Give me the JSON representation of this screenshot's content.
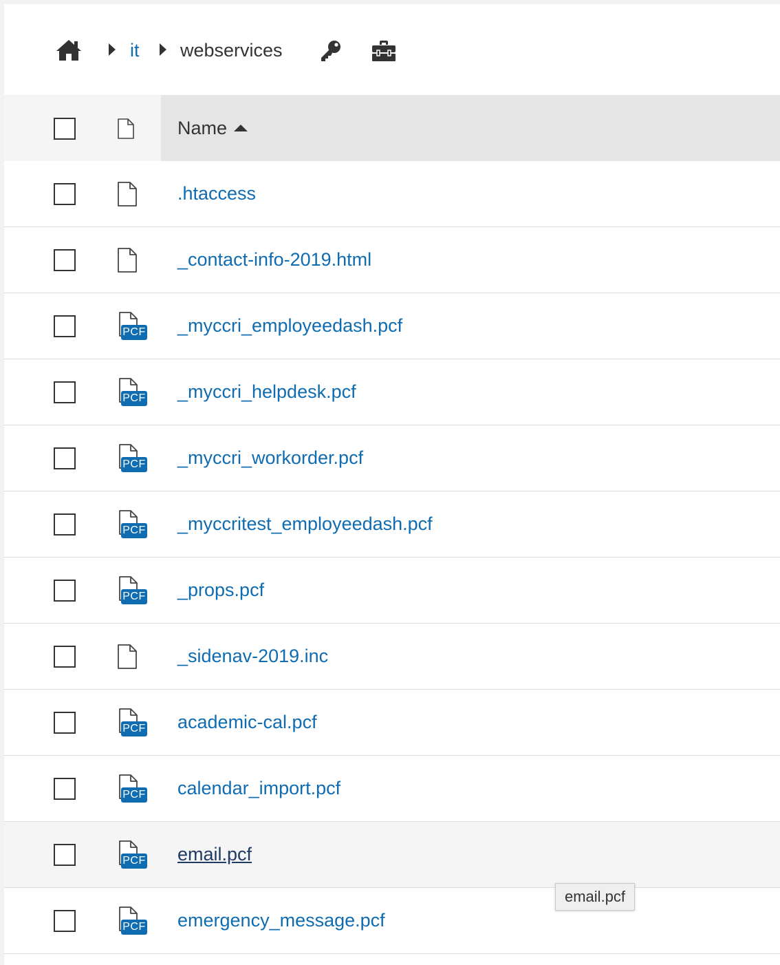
{
  "breadcrumb": {
    "home_icon": "home-icon",
    "separator_icon": "caret-right-icon",
    "items": [
      {
        "label": "it",
        "link": true
      },
      {
        "label": "webservices",
        "link": false
      }
    ],
    "actions": [
      "key-icon",
      "toolbox-icon"
    ]
  },
  "table": {
    "header": {
      "name_label": "Name",
      "sort": "ascending"
    },
    "rows": [
      {
        "name": ".htaccess",
        "type": "file"
      },
      {
        "name": "_contact-info-2019.html",
        "type": "file"
      },
      {
        "name": "_myccri_employeedash.pcf",
        "type": "pcf"
      },
      {
        "name": "_myccri_helpdesk.pcf",
        "type": "pcf"
      },
      {
        "name": "_myccri_workorder.pcf",
        "type": "pcf"
      },
      {
        "name": "_myccritest_employeedash.pcf",
        "type": "pcf"
      },
      {
        "name": "_props.pcf",
        "type": "pcf"
      },
      {
        "name": "_sidenav-2019.inc",
        "type": "file"
      },
      {
        "name": "academic-cal.pcf",
        "type": "pcf"
      },
      {
        "name": "calendar_import.pcf",
        "type": "pcf"
      },
      {
        "name": "email.pcf",
        "type": "pcf",
        "hovered": true
      },
      {
        "name": "emergency_message.pcf",
        "type": "pcf"
      }
    ],
    "pcf_badge_label": "PCF"
  },
  "tooltip": {
    "text": "email.pcf"
  },
  "colors": {
    "link": "#0f6cb0",
    "link_hover": "#1f3b63",
    "header_bg": "#e5e5e5",
    "row_hover_bg": "#f5f5f5",
    "badge_bg": "#0f6cb0"
  }
}
